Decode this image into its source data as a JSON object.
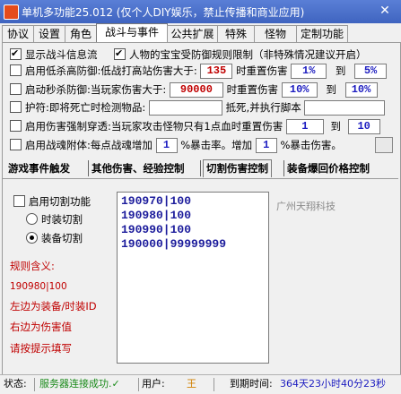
{
  "window": {
    "title": "单机多功能25.012 (仅个人DIY娱乐，禁止传播和商业应用)",
    "close_glyph": "✕"
  },
  "tabs": [
    "协议",
    "设置",
    "角色",
    "战斗与事件",
    "公共扩展",
    "特殊",
    "怪物",
    "定制功能"
  ],
  "options": {
    "show_battle_info": {
      "label": "显示战斗信息流",
      "checked": true
    },
    "pet_fix": {
      "label": "人物的宝宝受防御规则限制（非特殊情况建议开启）",
      "checked": true
    },
    "low_kill_def": {
      "label": "启用低杀高防御:低战打高站伤害大于:",
      "value": "135",
      "mid": "时重置伤害",
      "from": "1%",
      "to_label": "到",
      "to": "5%",
      "checked": false
    },
    "seckill_def": {
      "label": "启动秒杀防御:当玩家伤害大于:",
      "value": "90000",
      "mid": "时重置伤害",
      "from": "10%",
      "to_label": "到",
      "to": "10%",
      "checked": false
    },
    "guard": {
      "label": "护符:即将死亡时检测物品:",
      "mid": "抵死,并执行脚本",
      "checked": false
    },
    "force_penetrate": {
      "label": "启用伤害强制穿透:当玩家攻击怪物只有1点血时重置伤害",
      "from": "1",
      "to_label": "到",
      "to": "10",
      "checked": false
    },
    "war_soul": {
      "label": "启用战魂附体:每点战魂增加",
      "value1": "1",
      "mid": "%暴击率。增加",
      "value2": "1",
      "suffix": "%暴击伤害。",
      "checked": false
    }
  },
  "subtabs": [
    "游戏事件触发",
    "其他伤害、经验控制",
    "切割伤害控制",
    "装备爆回价格控制"
  ],
  "cut": {
    "enable_label": "启用切割功能",
    "radio_time": "时装切割",
    "radio_equip": "装备切割",
    "rules_title": "规则含义:",
    "example": "190980|100",
    "note1": "左边为装备/时装ID",
    "note2": "右边为伤害值",
    "note3": "请按提示填写",
    "lines": [
      "190970|100",
      "190980|100",
      "190990|100",
      "190000|99999999"
    ],
    "overlay_text": "广州天翔科技"
  },
  "status": {
    "state_label": "状态:",
    "server_msg": "服务器连接成功.✓",
    "user_label": "用户:",
    "user_value": "王",
    "expire_label": "到期时间:",
    "expire_value": "364天23小时40分23秒"
  }
}
